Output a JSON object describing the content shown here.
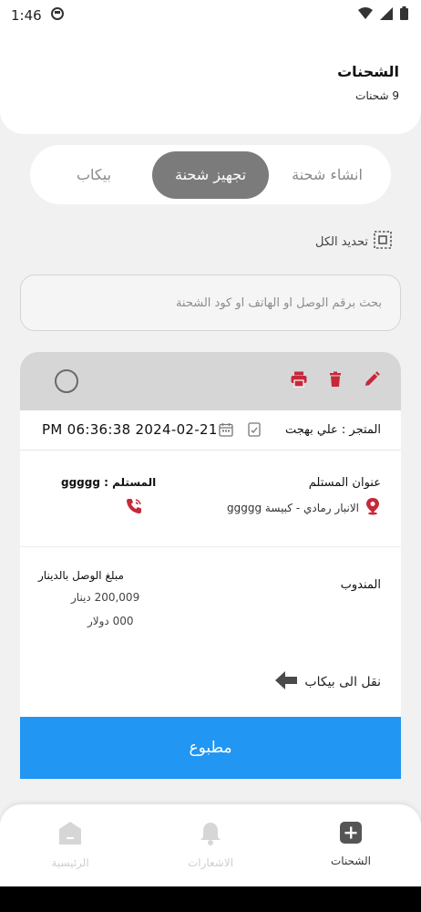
{
  "status_bar": {
    "time": "1:46"
  },
  "header": {
    "title": "الشحنات",
    "count": "9 شحنات"
  },
  "tabs": [
    {
      "label": "انشاء شحنة",
      "active": false
    },
    {
      "label": "تجهيز شحنة",
      "active": true
    },
    {
      "label": "بيكاب",
      "active": false
    }
  ],
  "select_all": {
    "label": "تحديد الكل"
  },
  "search": {
    "placeholder": "بحث برقم الوصل او الهاتف او كود الشحنة"
  },
  "shipment": {
    "store_label": "المتجر : علي بهجت",
    "datetime": "PM 06:36:38 2024-02-21",
    "receiver_address_label": "عنوان المستلم",
    "receiver_address_value": "الانبار رمادي - كبيسة ggggg",
    "receiver_label": "المستلم : ggggg",
    "representative_label": "المندوب",
    "amount_label": "مبلغ الوصل بالدينار",
    "amount_dinar": "200,009 دينار",
    "amount_dollar": "000 دولار",
    "move_label": "نقل الى بيكاب",
    "print_status": "مطبوع"
  },
  "bottom_nav": [
    {
      "label": "الشحنات",
      "icon": "plus-box-icon",
      "active": true
    },
    {
      "label": "الاشعارات",
      "icon": "bell-icon",
      "active": false
    },
    {
      "label": "الرئيسية",
      "icon": "home-icon",
      "active": false
    }
  ],
  "colors": {
    "accent": "#2196f3",
    "danger": "#c62839",
    "active_tab": "#7b7b7b"
  }
}
